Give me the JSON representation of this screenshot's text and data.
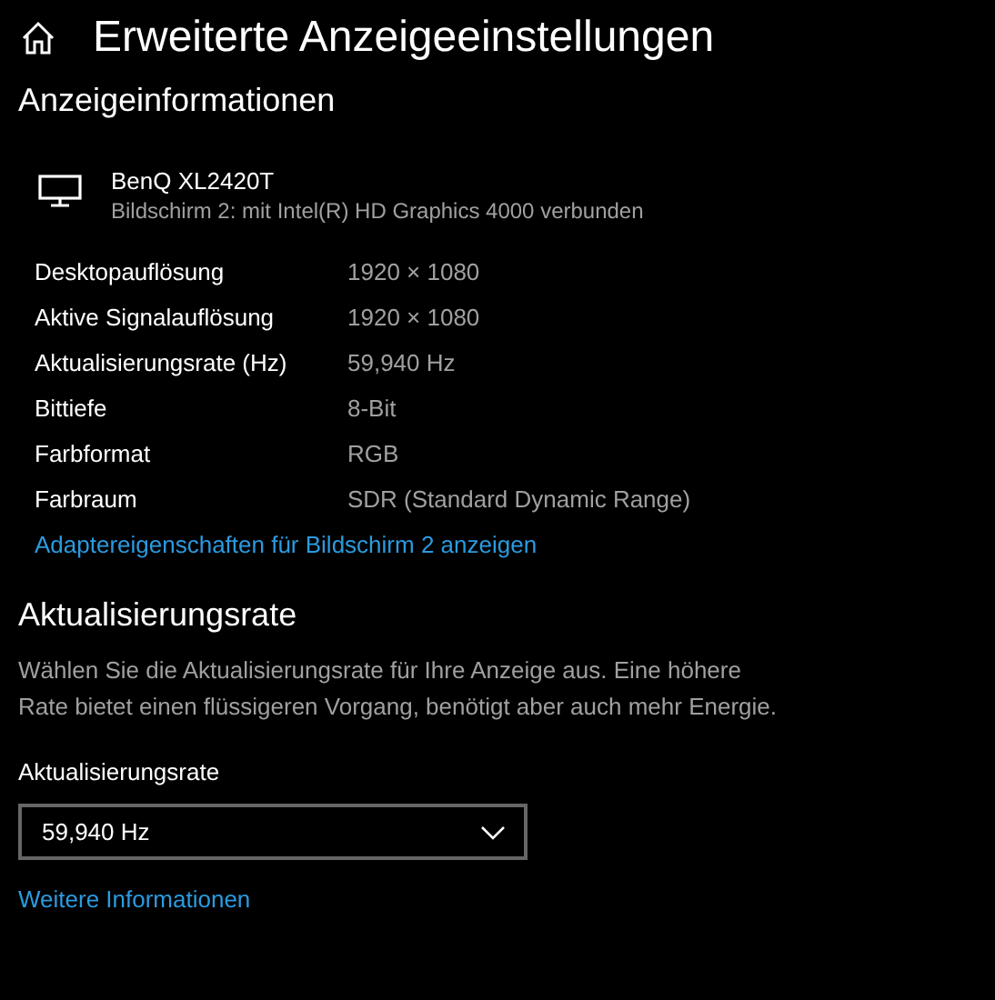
{
  "page": {
    "title": "Erweiterte Anzeigeeinstellungen"
  },
  "display_info": {
    "heading": "Anzeigeinformationen",
    "monitor_name": "BenQ XL2420T",
    "monitor_subtitle": "Bildschirm 2: mit Intel(R) HD Graphics 4000 verbunden",
    "rows": [
      {
        "label": "Desktopauflösung",
        "value": "1920 × 1080"
      },
      {
        "label": "Aktive Signalauflösung",
        "value": "1920 × 1080"
      },
      {
        "label": "Aktualisierungsrate (Hz)",
        "value": "59,940 Hz"
      },
      {
        "label": "Bittiefe",
        "value": "8-Bit"
      },
      {
        "label": "Farbformat",
        "value": "RGB"
      },
      {
        "label": "Farbraum",
        "value": "SDR (Standard Dynamic Range)"
      }
    ],
    "link": "Adaptereigenschaften für Bildschirm 2 anzeigen"
  },
  "refresh_rate": {
    "heading": "Aktualisierungsrate",
    "description": [
      "Wählen Sie die Aktualisierungsrate für Ihre Anzeige aus. Eine höhere",
      "Rate bietet einen flüssigeren Vorgang, benötigt aber auch mehr Energie."
    ],
    "dropdown_label": "Aktualisierungsrate",
    "dropdown_value": "59,940 Hz",
    "link": "Weitere Informationen"
  }
}
